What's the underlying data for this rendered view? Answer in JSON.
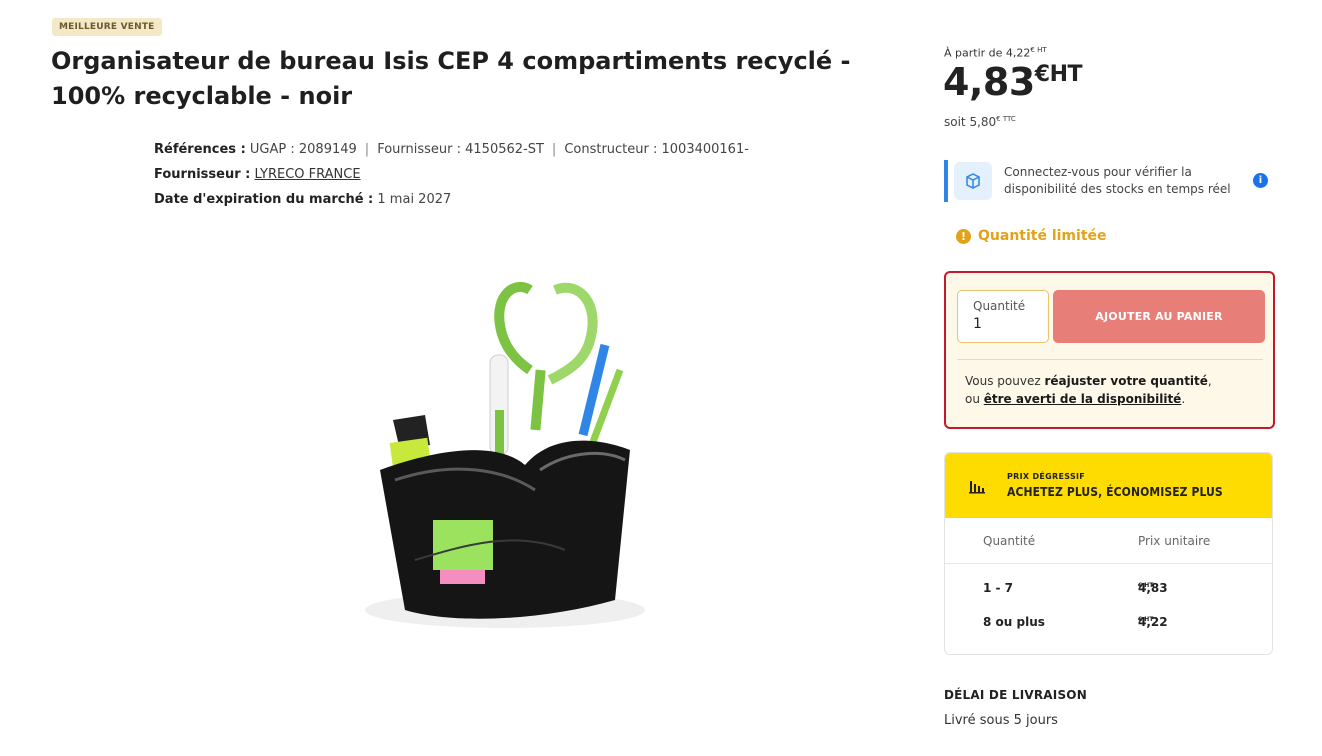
{
  "badge": "MEILLEURE VENTE",
  "product": {
    "title": "Organisateur de bureau Isis CEP 4 compartiments recyclé - 100% recyclable - noir",
    "references_label": "Références :",
    "ugap": "UGAP : 2089149",
    "fournisseur_ref": "Fournisseur : 4150562-ST",
    "constructeur_ref": "Constructeur : 1003400161-",
    "supplier_label": "Fournisseur :",
    "supplier_name": "LYRECO FRANCE",
    "expiry_label": "Date d'expiration du marché :",
    "expiry_value": "1 mai 2027"
  },
  "pricing": {
    "from_text": "À partir de 4,22",
    "from_sup": "€ HT",
    "price": "4,83",
    "price_unit": "€HT",
    "ttc_text": "soit 5,80",
    "ttc_sup": "€ TTC"
  },
  "stock_notice": {
    "text": "Connectez-vous pour vérifier la disponibilité des stocks en temps réel",
    "info_glyph": "i"
  },
  "limited": {
    "glyph": "!",
    "text": "Quantité limitée"
  },
  "cart": {
    "qty_label": "Quantité",
    "qty_value": "1",
    "add_label": "AJOUTER AU PANIER",
    "note_prefix": "Vous pouvez ",
    "note_bold": "réajuster votre quantité",
    "note_comma": ",",
    "note_or": "ou ",
    "note_link": "être averti de la disponibilité",
    "note_end": "."
  },
  "degressive": {
    "small": "PRIX DÉGRESSIF",
    "big": "ACHETEZ PLUS, ÉCONOMISEZ PLUS",
    "col_qty": "Quantité",
    "col_price": "Prix unitaire",
    "rows": [
      {
        "qty": "1 - 7",
        "price": "4,83",
        "unit": "€ HT"
      },
      {
        "qty": "8 ou plus",
        "price": "4,22",
        "unit": "€ HT"
      }
    ]
  },
  "delivery": {
    "title": "DÉLAI DE LIVRAISON",
    "value": "Livré sous 5 jours"
  },
  "colors": {
    "accent_yellow": "#ffdc00",
    "cart_border": "#c4182b",
    "add_button": "#e87e78",
    "info_blue": "#1a73e8",
    "warning": "#e3a21a"
  }
}
